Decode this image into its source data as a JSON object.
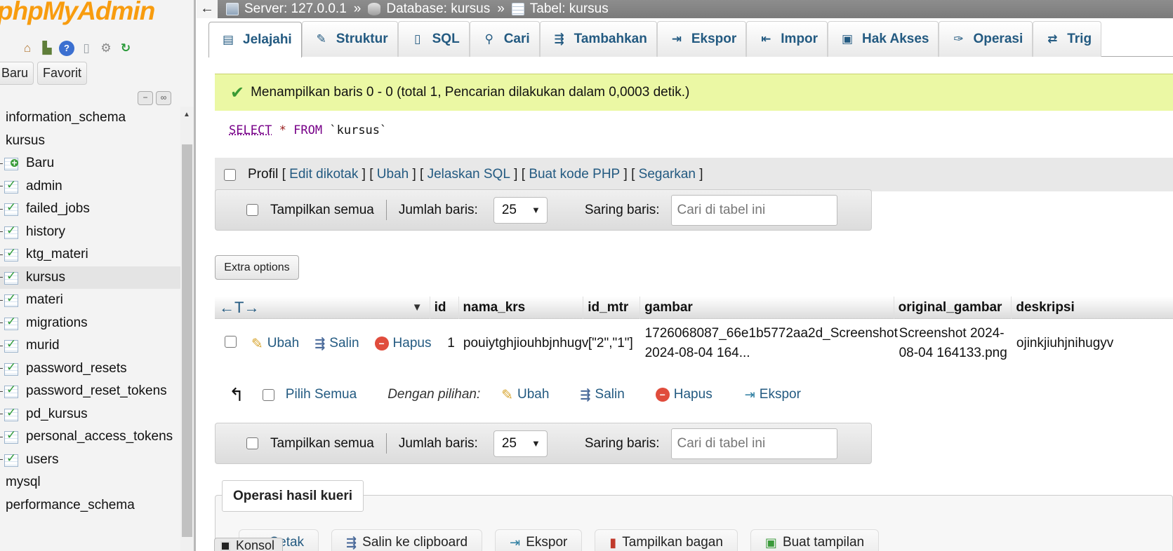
{
  "nav": {
    "logo_php": "php",
    "logo_myadmin": "MyAdmin",
    "tab_new": "Baru",
    "tab_fav": "Favorit",
    "tree": [
      {
        "kind": "db",
        "label": "information_schema"
      },
      {
        "kind": "db",
        "label": "kursus"
      },
      {
        "kind": "new",
        "label": "Baru"
      },
      {
        "kind": "tbl",
        "label": "admin"
      },
      {
        "kind": "tbl",
        "label": "failed_jobs"
      },
      {
        "kind": "tbl",
        "label": "history"
      },
      {
        "kind": "tbl",
        "label": "ktg_materi"
      },
      {
        "kind": "tbl",
        "label": "kursus",
        "selected": true
      },
      {
        "kind": "tbl",
        "label": "materi"
      },
      {
        "kind": "tbl",
        "label": "migrations"
      },
      {
        "kind": "tbl",
        "label": "murid"
      },
      {
        "kind": "tbl",
        "label": "password_resets"
      },
      {
        "kind": "tbl",
        "label": "password_reset_tokens"
      },
      {
        "kind": "tbl",
        "label": "pd_kursus"
      },
      {
        "kind": "tbl",
        "label": "personal_access_tokens"
      },
      {
        "kind": "tbl",
        "label": "users"
      },
      {
        "kind": "db",
        "label": "mysql"
      },
      {
        "kind": "db",
        "label": "performance_schema"
      }
    ]
  },
  "breadcrumb": {
    "back": "←",
    "server": "Server: 127.0.0.1",
    "database": "Database: kursus",
    "table": "Tabel: kursus",
    "sep": "»"
  },
  "tabs": [
    {
      "label": "Jelajahi",
      "icon": "browse-icon",
      "glyph": "▤",
      "active": true
    },
    {
      "label": "Struktur",
      "icon": "structure-icon",
      "glyph": "✎"
    },
    {
      "label": "SQL",
      "icon": "sql-icon",
      "glyph": "▯"
    },
    {
      "label": "Cari",
      "icon": "search-icon",
      "glyph": "⚲"
    },
    {
      "label": "Tambahkan",
      "icon": "insert-icon",
      "glyph": "⇶"
    },
    {
      "label": "Ekspor",
      "icon": "export-icon",
      "glyph": "⇥"
    },
    {
      "label": "Impor",
      "icon": "import-icon",
      "glyph": "⇤"
    },
    {
      "label": "Hak Akses",
      "icon": "privileges-icon",
      "glyph": "▣"
    },
    {
      "label": "Operasi",
      "icon": "wrench-icon",
      "glyph": "✑"
    },
    {
      "label": "Trig",
      "icon": "triggers-icon",
      "glyph": "⇄"
    }
  ],
  "message": "Menampilkan baris 0 - 0 (total 1, Pencarian dilakukan dalam 0,0003 detik.)",
  "sql": {
    "select": "SELECT",
    "star": "*",
    "from": "FROM",
    "table": "`kursus`"
  },
  "profile": {
    "label": "Profil",
    "edit_inline": "Edit dikotak",
    "edit": "Ubah",
    "explain": "Jelaskan SQL",
    "php": "Buat kode PHP",
    "refresh": "Segarkan"
  },
  "navbar": {
    "show_all": "Tampilkan semua",
    "rows_label": "Jumlah baris:",
    "rows_value": "25",
    "filter_label": "Saring baris:",
    "filter_placeholder": "Cari di tabel ini"
  },
  "extra_options": "Extra options",
  "table": {
    "columns": [
      "id",
      "nama_krs",
      "id_mtr",
      "gambar",
      "original_gambar",
      "deskripsi"
    ],
    "sort_arrows": "←T→",
    "row": {
      "edit": "Ubah",
      "copy": "Salin",
      "delete": "Hapus",
      "id": "1",
      "nama_krs": "pouiytghjiouhbjnhugv",
      "id_mtr": "[\"2\",\"1\"]",
      "gambar": "1726068087_66e1b5772aa2d_Screenshot 2024-08-04 164...",
      "original_gambar": "Screenshot 2024-08-04 164133.png",
      "deskripsi": "ojinkjiuhjnihugyv"
    }
  },
  "bulk": {
    "select_all": "Pilih Semua",
    "with_selected": "Dengan pilihan:",
    "edit": "Ubah",
    "copy": "Salin",
    "delete": "Hapus",
    "export": "Ekspor"
  },
  "ops": {
    "legend": "Operasi hasil kueri",
    "print": "Cetak",
    "clipboard": "Salin ke clipboard",
    "export": "Ekspor",
    "chart": "Tampilkan bagan",
    "view": "Buat tampilan"
  },
  "console": "Konsol"
}
